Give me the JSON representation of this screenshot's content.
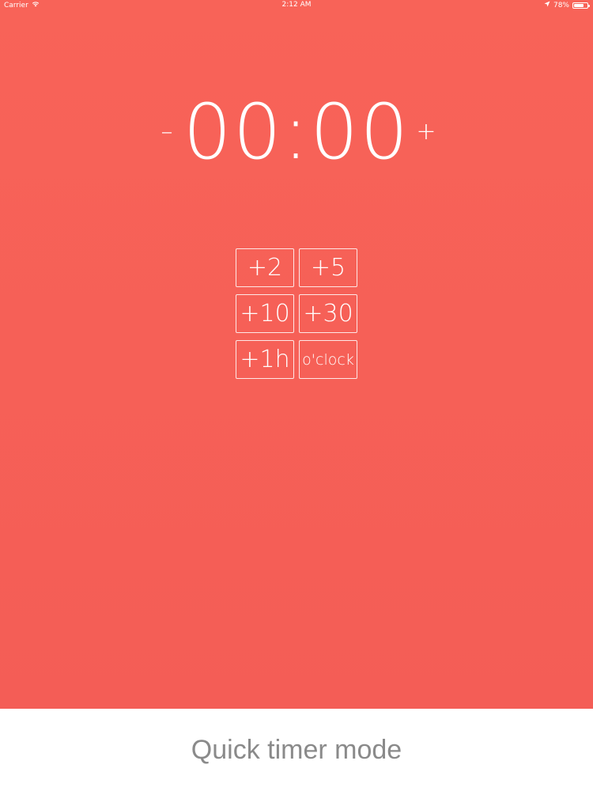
{
  "status_bar": {
    "carrier": "Carrier",
    "time": "2:12 AM",
    "battery": "78%",
    "battery_level": 0.78,
    "wifi_icon": "wifi-icon",
    "location_icon": "location-arrow-icon"
  },
  "timer": {
    "display": "00:00",
    "minus_label": "–",
    "plus_label": "+"
  },
  "quick_buttons": [
    {
      "label": "+2"
    },
    {
      "label": "+5"
    },
    {
      "label": "+10"
    },
    {
      "label": "+30"
    },
    {
      "label": "+1h"
    },
    {
      "label": "o'clock"
    }
  ],
  "bottom": {
    "mode_label": "Quick timer mode"
  },
  "colors": {
    "background": "#f86358",
    "foreground": "#ffffff",
    "bottom_bar": "#ffffff",
    "bottom_text": "#8a8a8a"
  }
}
